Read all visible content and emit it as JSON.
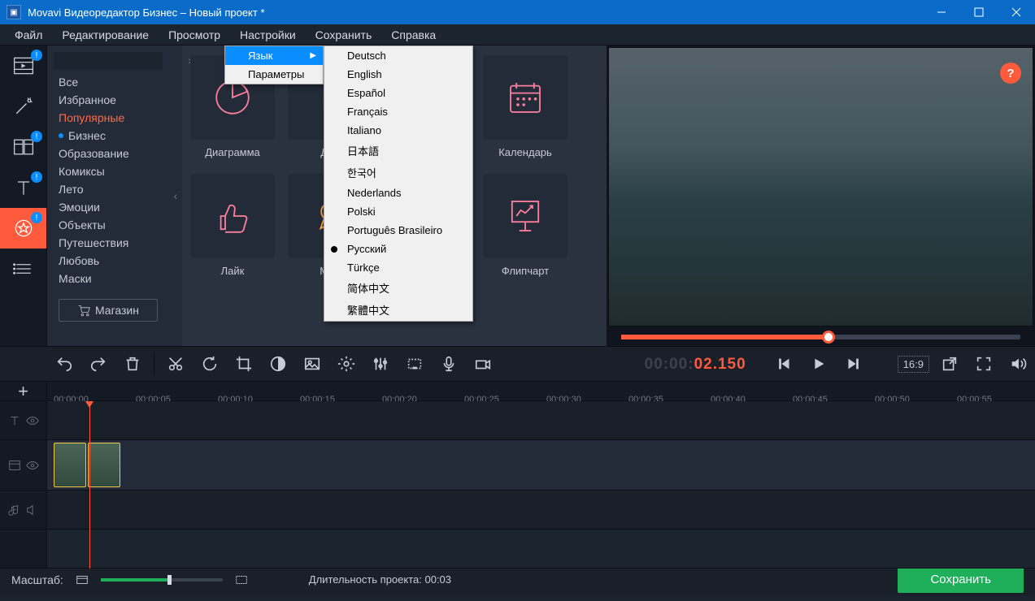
{
  "window": {
    "title": "Movavi Видеоредактор Бизнес – Новый проект *"
  },
  "menus": [
    "Файл",
    "Редактирование",
    "Просмотр",
    "Настройки",
    "Сохранить",
    "Справка"
  ],
  "settings_menu": {
    "language": "Язык",
    "params": "Параметры"
  },
  "languages": [
    "Deutsch",
    "English",
    "Español",
    "Français",
    "Italiano",
    "日本語",
    "한국어",
    "Nederlands",
    "Polski",
    "Português Brasileiro",
    "Русский",
    "Türkçe",
    "简体中文",
    "繁體中文"
  ],
  "language_selected": "Русский",
  "search": {
    "placeholder": ""
  },
  "categories": [
    "Все",
    "Избранное",
    "Популярные",
    "Бизнес",
    "Образование",
    "Комиксы",
    "Лето",
    "Эмоции",
    "Объекты",
    "Путешествия",
    "Любовь",
    "Маски"
  ],
  "category_selected": "Популярные",
  "category_dotted": "Бизнес",
  "shop": "Магазин",
  "stickers": {
    "r1": [
      "Диаграмма",
      "Дол",
      "",
      "Календарь"
    ],
    "r2": [
      "Лайк",
      "Мед",
      "",
      "Флипчарт"
    ]
  },
  "help_icon": "?",
  "timecode": {
    "gray": "00:00:",
    "red": "02.150"
  },
  "aspect": "16:9",
  "ruler": [
    "00:00:00",
    "00:00:05",
    "00:00:10",
    "00:00:15",
    "00:00:20",
    "00:00:25",
    "00:00:30",
    "00:00:35",
    "00:00:40",
    "00:00:45",
    "00:00:50",
    "00:00:55"
  ],
  "status": {
    "zoom_label": "Масштаб:",
    "duration": "Длительность проекта:  00:03",
    "save": "Сохранить"
  }
}
